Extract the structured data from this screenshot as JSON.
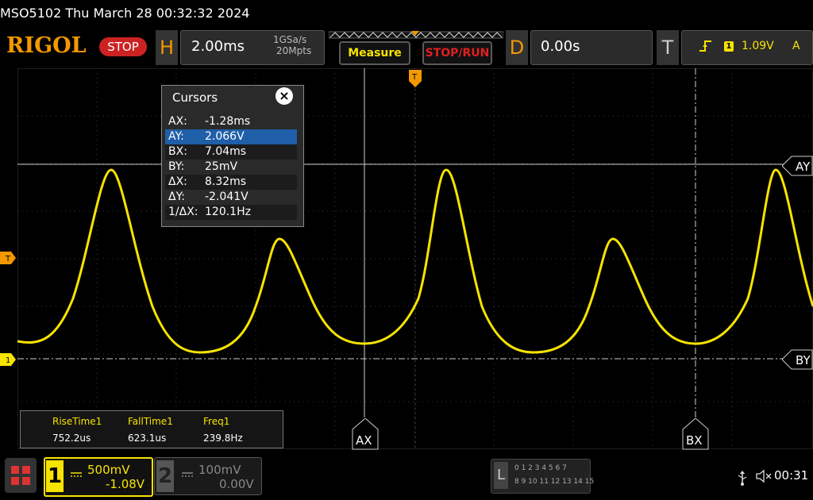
{
  "titlebar": {
    "text": "MSO5102  Thu March 28 00:32:32 2024"
  },
  "brand": {
    "logo": "RIGOL",
    "run_state": "STOP",
    "accent": "#f39800"
  },
  "horizontal": {
    "letter": "H",
    "timebase": "2.00ms",
    "sample_rate": "1GSa/s",
    "memory_depth": "20Mpts"
  },
  "buttons": {
    "measure": "Measure",
    "stop_run": "STOP/RUN"
  },
  "delay": {
    "letter": "D",
    "value": "0.00s"
  },
  "trigger": {
    "letter": "T",
    "edge_icon": "rising-edge-icon",
    "channel": "1",
    "level": "1.09V",
    "mode": "A"
  },
  "cursors": {
    "title": "Cursors",
    "close_icon": "close-icon",
    "rows": [
      {
        "key": "AX:",
        "value": "-1.28ms"
      },
      {
        "key": "AY:",
        "value": "2.066V"
      },
      {
        "key": "BX:",
        "value": "7.04ms"
      },
      {
        "key": "BY:",
        "value": "25mV"
      },
      {
        "key": "ΔX:",
        "value": "8.32ms"
      },
      {
        "key": "ΔY:",
        "value": "-2.041V"
      },
      {
        "key": "1/ΔX:",
        "value": "120.1Hz"
      }
    ],
    "selected_index": 1,
    "labels": {
      "ax": "AX",
      "bx": "BX",
      "ay": "AY",
      "by": "BY"
    }
  },
  "markers": {
    "trigger_level": "T",
    "ch1_ground": "1",
    "trigger_pos": "T"
  },
  "measurements": [
    {
      "label": "RiseTime1",
      "value": "752.2us"
    },
    {
      "label": "FallTime1",
      "value": "623.1us"
    },
    {
      "label": "Freq1",
      "value": "239.8Hz"
    }
  ],
  "channels": {
    "ch1": {
      "number": "1",
      "coupling_icon": "dc-coupling-icon",
      "scale": "500mV",
      "offset": "-1.08V",
      "color": "#f7e300"
    },
    "ch2": {
      "number": "2",
      "coupling_icon": "dc-coupling-icon",
      "scale": "100mV",
      "offset": "0.00V",
      "color": "#888888"
    }
  },
  "logic": {
    "letter": "L",
    "row1": "0 1 2 3   4 5 6 7",
    "row2": "8  9 10 11  12 13 14 15"
  },
  "status": {
    "usb_icon": "usb-icon",
    "speaker_icon": "speaker-muted-icon",
    "clock": "00:31"
  }
}
